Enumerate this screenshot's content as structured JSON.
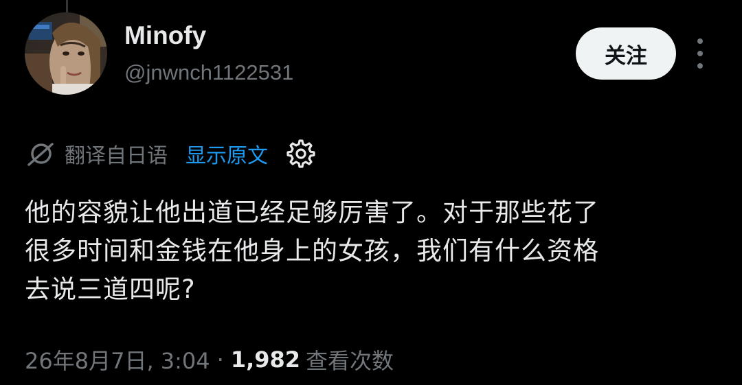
{
  "author": {
    "display_name": "Minofy",
    "handle": "@jnwnch1122531"
  },
  "actions": {
    "follow_label": "关注",
    "more_icon": "more-vertical-icon"
  },
  "translation": {
    "translated_from": "翻译自日语",
    "show_original": "显示原文",
    "translate_icon": "translate-icon",
    "settings_icon": "gear-icon"
  },
  "tweet": {
    "text_lines": [
      "他的容貌让他出道已经足够厉害了。对于那些花了",
      "很多时间和金钱在他身上的女孩，我们有什么资格",
      "去说三道四呢?"
    ]
  },
  "meta": {
    "timestamp": "26年8月7日, 3:04",
    "separator": "·",
    "views_count": "1,982",
    "views_label": "查看次数"
  },
  "colors": {
    "background": "#000000",
    "text_primary": "#e7e9ea",
    "text_secondary": "#71767b",
    "link": "#1d9bf0",
    "follow_bg": "#eff3f4"
  }
}
